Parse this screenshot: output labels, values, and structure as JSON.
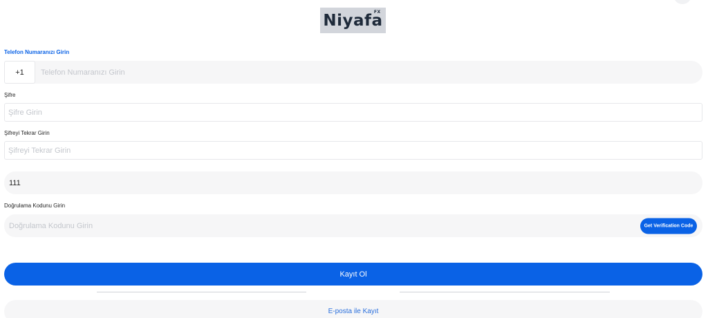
{
  "logo": {
    "text": "Niyafa",
    "sup": "FX"
  },
  "phone": {
    "label": "Telefon Numaranızı Girin",
    "country_code": "+1",
    "placeholder": "Telefon Numaranızı Girin"
  },
  "password": {
    "label": "Şifre",
    "placeholder": "Şifre Girin"
  },
  "password_repeat": {
    "label": "Şifreyi Tekrar Girin",
    "placeholder": "Şifreyi Tekrar Girin"
  },
  "referral": {
    "value": "111"
  },
  "verification": {
    "label": "Doğrulama Kodunu Girin",
    "placeholder": "Doğrulama Kodunu Girin",
    "button": "Get Verification Code"
  },
  "actions": {
    "register": "Kayıt Ol",
    "email_register": "E-posta ile Kayıt"
  }
}
